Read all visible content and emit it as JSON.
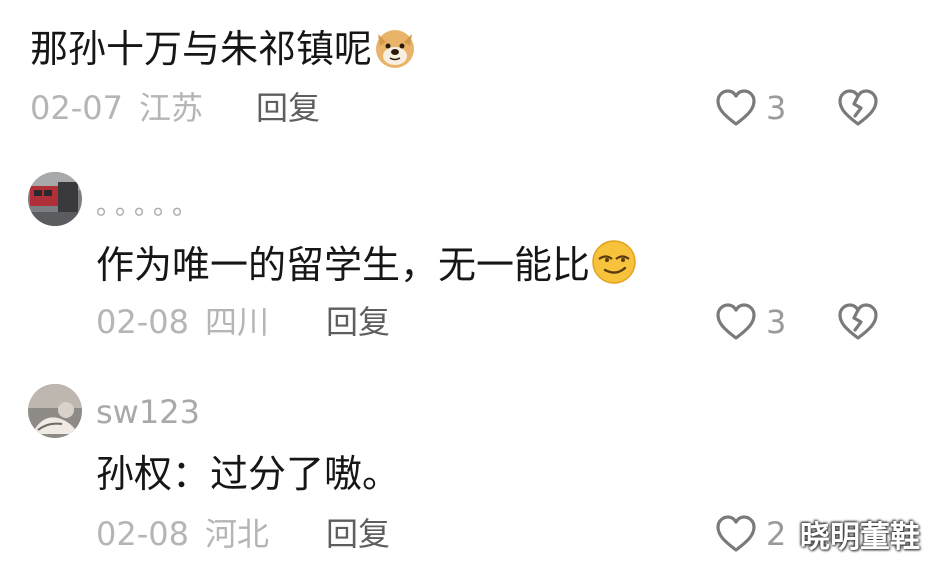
{
  "comments": [
    {
      "text": "那孙十万与朱祁镇呢",
      "emoji": "doge-emoji",
      "date": "02-07",
      "location": "江苏",
      "reply_label": "回复",
      "like_count": "3"
    },
    {
      "username": "。。。。。",
      "text": "作为唯一的留学生，无一能比",
      "emoji": "smirk-emoji",
      "date": "02-08",
      "location": "四川",
      "reply_label": "回复",
      "like_count": "3"
    },
    {
      "username": "sw123",
      "text": "孙权：过分了嗷。",
      "date": "02-08",
      "location": "河北",
      "reply_label": "回复",
      "like_count": "2"
    }
  ],
  "watermark": "晓明董鞋",
  "colors": {
    "text": "#161616",
    "meta": "#b5b5b5",
    "reply": "#5e5e5e",
    "icon": "#7a7a7a"
  }
}
